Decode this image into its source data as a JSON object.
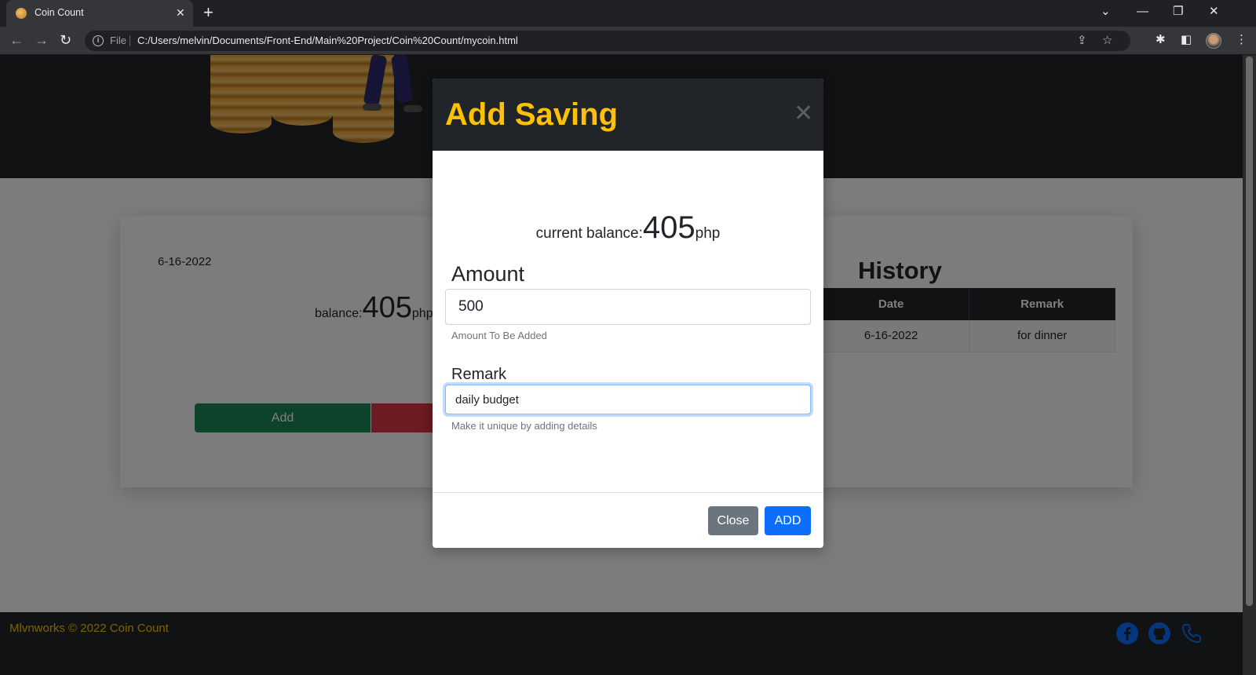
{
  "browser": {
    "tab_title": "Coin Count",
    "scheme_label": "File",
    "url": "C:/Users/melvin/Documents/Front-End/Main%20Project/Coin%20Count/mycoin.html"
  },
  "card": {
    "date": "6-16-2022",
    "balance_label": "balance:",
    "balance_value": "405",
    "balance_unit": "php",
    "add_label": "Add"
  },
  "history": {
    "title": "History",
    "columns": [
      "Date",
      "Remark"
    ],
    "rows": [
      {
        "date": "6-16-2022",
        "remark": "for dinner"
      }
    ]
  },
  "footer": {
    "text": "Mlvnworks © 2022 Coin Count",
    "icons": [
      "facebook-icon",
      "github-icon",
      "phone-icon"
    ],
    "icon_color": "#0d6efd"
  },
  "modal": {
    "title": "Add Saving",
    "current_balance_label": "current balance:",
    "current_balance_value": "405",
    "current_balance_unit": "php",
    "amount_label": "Amount",
    "amount_value": "500",
    "amount_help": "Amount To Be Added",
    "remark_label": "Remark",
    "remark_value": "daily budget",
    "remark_help": "Make it unique by adding details",
    "close_label": "Close",
    "add_label": "ADD"
  },
  "colors": {
    "accent_yellow": "#ffc107",
    "dark": "#212529",
    "success": "#198754",
    "danger": "#dc3545",
    "primary": "#0d6efd",
    "secondary": "#6c757d"
  }
}
